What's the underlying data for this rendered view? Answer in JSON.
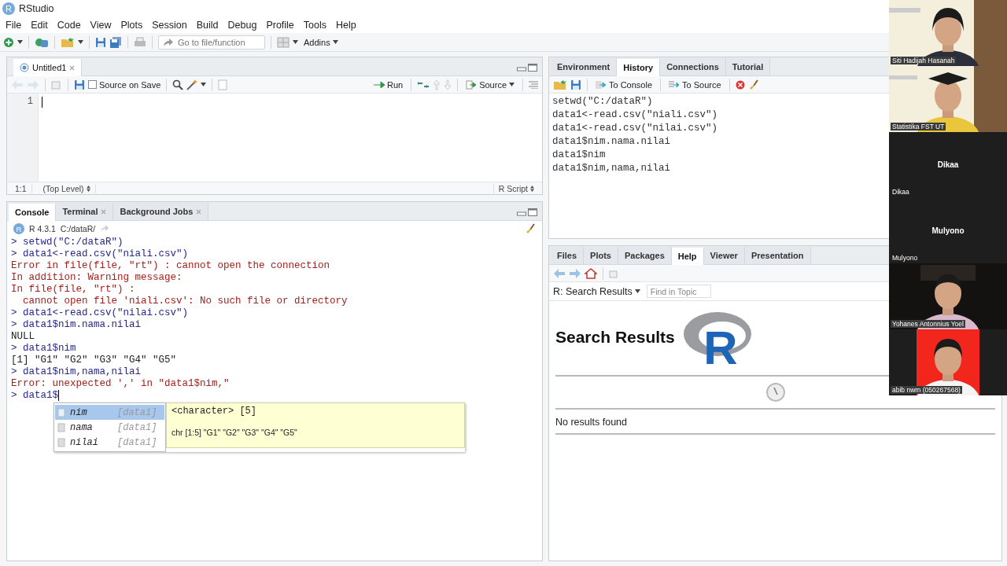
{
  "window": {
    "title": "RStudio",
    "logo_text": "R"
  },
  "menu": [
    "File",
    "Edit",
    "Code",
    "View",
    "Plots",
    "Session",
    "Build",
    "Debug",
    "Profile",
    "Tools",
    "Help"
  ],
  "toolbar": {
    "goto": {
      "placeholder": "Go to file/function"
    },
    "addins": "Addins"
  },
  "editor": {
    "tabs": [
      {
        "label": "Untitled1",
        "selected": true
      }
    ],
    "source_on_save": {
      "label": "Source on Save",
      "checked": false
    },
    "run": "Run",
    "source": "Source",
    "line_numbers": [
      "1"
    ],
    "status": {
      "position": "1:1",
      "scope": "(Top Level)",
      "type": "R Script"
    }
  },
  "console": {
    "tabs": [
      {
        "label": "Console",
        "selected": true,
        "closable": false
      },
      {
        "label": "Terminal",
        "selected": false,
        "closable": true
      },
      {
        "label": "Background Jobs",
        "selected": false,
        "closable": true
      }
    ],
    "logo_text": "R",
    "version": "R 4.3.1",
    "path": "C:/dataR/",
    "lines": [
      {
        "kind": "input",
        "text": "> setwd(\"C:/dataR\")"
      },
      {
        "kind": "input",
        "text": "> data1<-read.csv(\"niali.csv\")"
      },
      {
        "kind": "error",
        "text": "Error in file(file, \"rt\") : cannot open the connection"
      },
      {
        "kind": "error",
        "text": "In addition: Warning message:"
      },
      {
        "kind": "error",
        "text": "In file(file, \"rt\") :"
      },
      {
        "kind": "error",
        "text": "  cannot open file 'niali.csv': No such file or directory"
      },
      {
        "kind": "input",
        "text": "> data1<-read.csv(\"nilai.csv\")"
      },
      {
        "kind": "input",
        "text": "> data1$nim.nama.nilai"
      },
      {
        "kind": "output",
        "text": "NULL"
      },
      {
        "kind": "input",
        "text": "> data1$nim"
      },
      {
        "kind": "output",
        "text": "[1] \"G1\" \"G2\" \"G3\" \"G4\" \"G5\""
      },
      {
        "kind": "input",
        "text": "> data1$nim,nama,nilai"
      },
      {
        "kind": "error",
        "text": "Error: unexpected ',' in \"data1$nim,\""
      },
      {
        "kind": "input",
        "text": "> data1$",
        "cursor": true
      }
    ],
    "completion": {
      "items": [
        {
          "name": "nim",
          "source": "[data1]",
          "selected": true
        },
        {
          "name": "nama",
          "source": "[data1]",
          "selected": false
        },
        {
          "name": "nilai",
          "source": "[data1]",
          "selected": false
        }
      ],
      "type": "<character> [5]",
      "preview": "chr [1:5] \"G1\" \"G2\" \"G3\" \"G4\" \"G5\""
    }
  },
  "environment": {
    "tabs": [
      {
        "label": "Environment",
        "selected": false
      },
      {
        "label": "History",
        "selected": true
      },
      {
        "label": "Connections",
        "selected": false
      },
      {
        "label": "Tutorial",
        "selected": false
      }
    ],
    "to_console": "To Console",
    "to_source": "To Source",
    "history": [
      "setwd(\"C:/dataR\")",
      "data1<-read.csv(\"niali.csv\")",
      "data1<-read.csv(\"nilai.csv\")",
      "data1$nim.nama.nilai",
      "data1$nim",
      "data1$nim,nama,nilai"
    ]
  },
  "help": {
    "tabs": [
      {
        "label": "Files",
        "selected": false
      },
      {
        "label": "Plots",
        "selected": false
      },
      {
        "label": "Packages",
        "selected": false
      },
      {
        "label": "Help",
        "selected": true
      },
      {
        "label": "Viewer",
        "selected": false
      },
      {
        "label": "Presentation",
        "selected": false
      }
    ],
    "topic": "R: Search Results",
    "find": {
      "placeholder": "Find in Topic"
    },
    "heading": "Search Results",
    "logo_text": "R",
    "message": "No results found"
  },
  "participants": [
    {
      "kind": "picture",
      "name": "Siti Hadijah Hasanah"
    },
    {
      "kind": "picture",
      "name": "Statistika FST UT"
    },
    {
      "kind": "name_only",
      "title": "Dikaa",
      "name": "Dikaa"
    },
    {
      "kind": "name_only",
      "title": "Mulyono",
      "name": "Mulyono"
    },
    {
      "kind": "picture",
      "name": "Yohanes Antonnius Yoel"
    },
    {
      "kind": "picture",
      "name": "abib nwm (050267568)"
    }
  ]
}
